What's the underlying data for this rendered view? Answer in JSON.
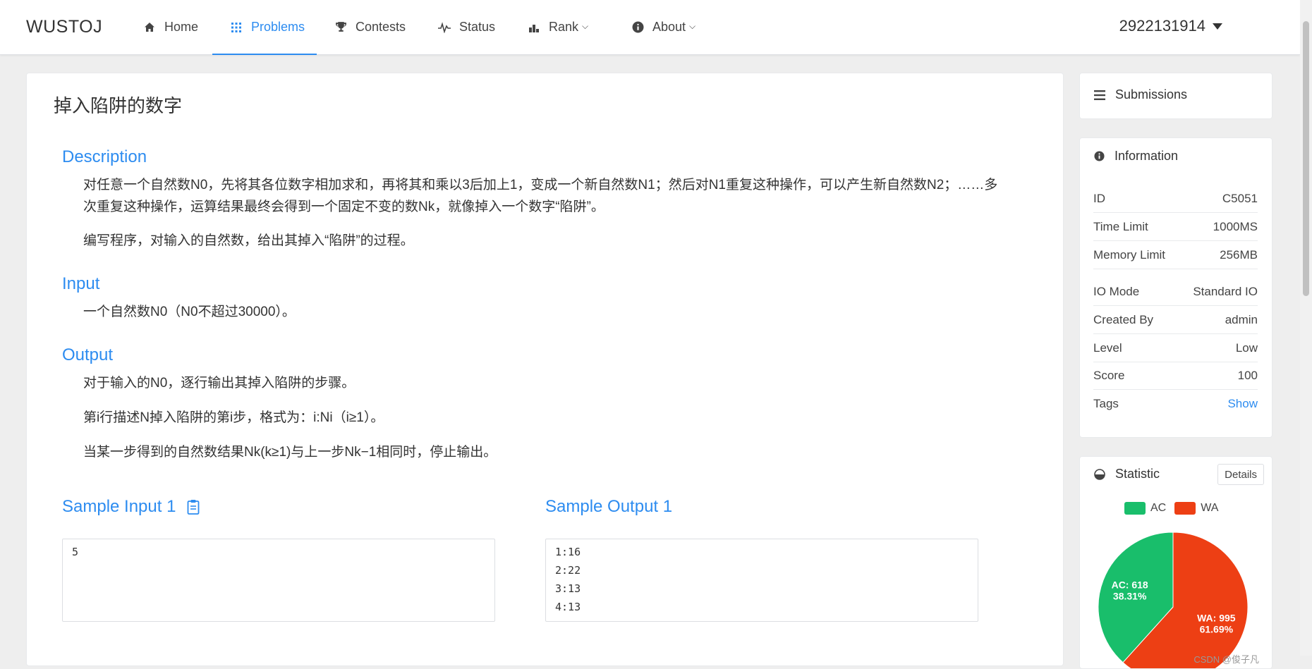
{
  "navbar": {
    "brand": "WUSTOJ",
    "items": [
      {
        "label": "Home",
        "icon": "home-icon"
      },
      {
        "label": "Problems",
        "icon": "grid-icon"
      },
      {
        "label": "Contests",
        "icon": "trophy-icon"
      },
      {
        "label": "Status",
        "icon": "pulse-icon"
      },
      {
        "label": "Rank",
        "icon": "bar-chart-icon"
      },
      {
        "label": "About",
        "icon": "info-circle-icon"
      }
    ],
    "active": "Problems",
    "user": "2922131914"
  },
  "problem": {
    "title": "掉入陷阱的数字",
    "description_heading": "Description",
    "description": [
      "对任意一个自然数N0，先将其各位数字相加求和，再将其和乘以3后加上1，变成一个新自然数N1；然后对N1重复这种操作，可以产生新自然数N2；……多次重复这种操作，运算结果最终会得到一个固定不变的数Nk，就像掉入一个数字“陷阱”。",
      "编写程序，对输入的自然数，给出其掉入“陷阱”的过程。"
    ],
    "input_heading": "Input",
    "input": "一个自然数N0（N0不超过30000）。",
    "output_heading": "Output",
    "output": [
      "对于输入的N0，逐行输出其掉入陷阱的步骤。",
      "第i行描述N掉入陷阱的第i步，格式为：i:Ni（i≥1）。",
      "当某一步得到的自然数结果Nk(k≥1)与上一步Nk−1相同时，停止输出。"
    ],
    "sample_input_heading": "Sample Input 1",
    "sample_output_heading": "Sample Output 1",
    "sample_input": [
      "5"
    ],
    "sample_output": [
      "1:16",
      "2:22",
      "3:13",
      "4:13"
    ]
  },
  "sidebar": {
    "submissions_label": "Submissions",
    "information_label": "Information",
    "info": [
      {
        "k": "ID",
        "v": "C5051"
      },
      {
        "k": "Time Limit",
        "v": "1000MS"
      },
      {
        "k": "Memory Limit",
        "v": "256MB"
      },
      {
        "k": "IO Mode",
        "v": "Standard IO"
      },
      {
        "k": "Created By",
        "v": "admin"
      },
      {
        "k": "Level",
        "v": "Low"
      },
      {
        "k": "Score",
        "v": "100"
      },
      {
        "k": "Tags",
        "v": "Show"
      }
    ],
    "statistic_label": "Statistic",
    "details_label": "Details"
  },
  "colors": {
    "accent": "#2d8cf0",
    "ac": "#19be6b",
    "wa": "#ed3f14"
  },
  "chart_data": {
    "type": "pie",
    "categories": [
      "AC",
      "WA"
    ],
    "values": [
      618,
      995
    ],
    "labels": [
      "AC: 618\n38.31%",
      "WA: 995\n61.69%"
    ],
    "legend": "top"
  },
  "watermark": "CSDN @俊子凡"
}
